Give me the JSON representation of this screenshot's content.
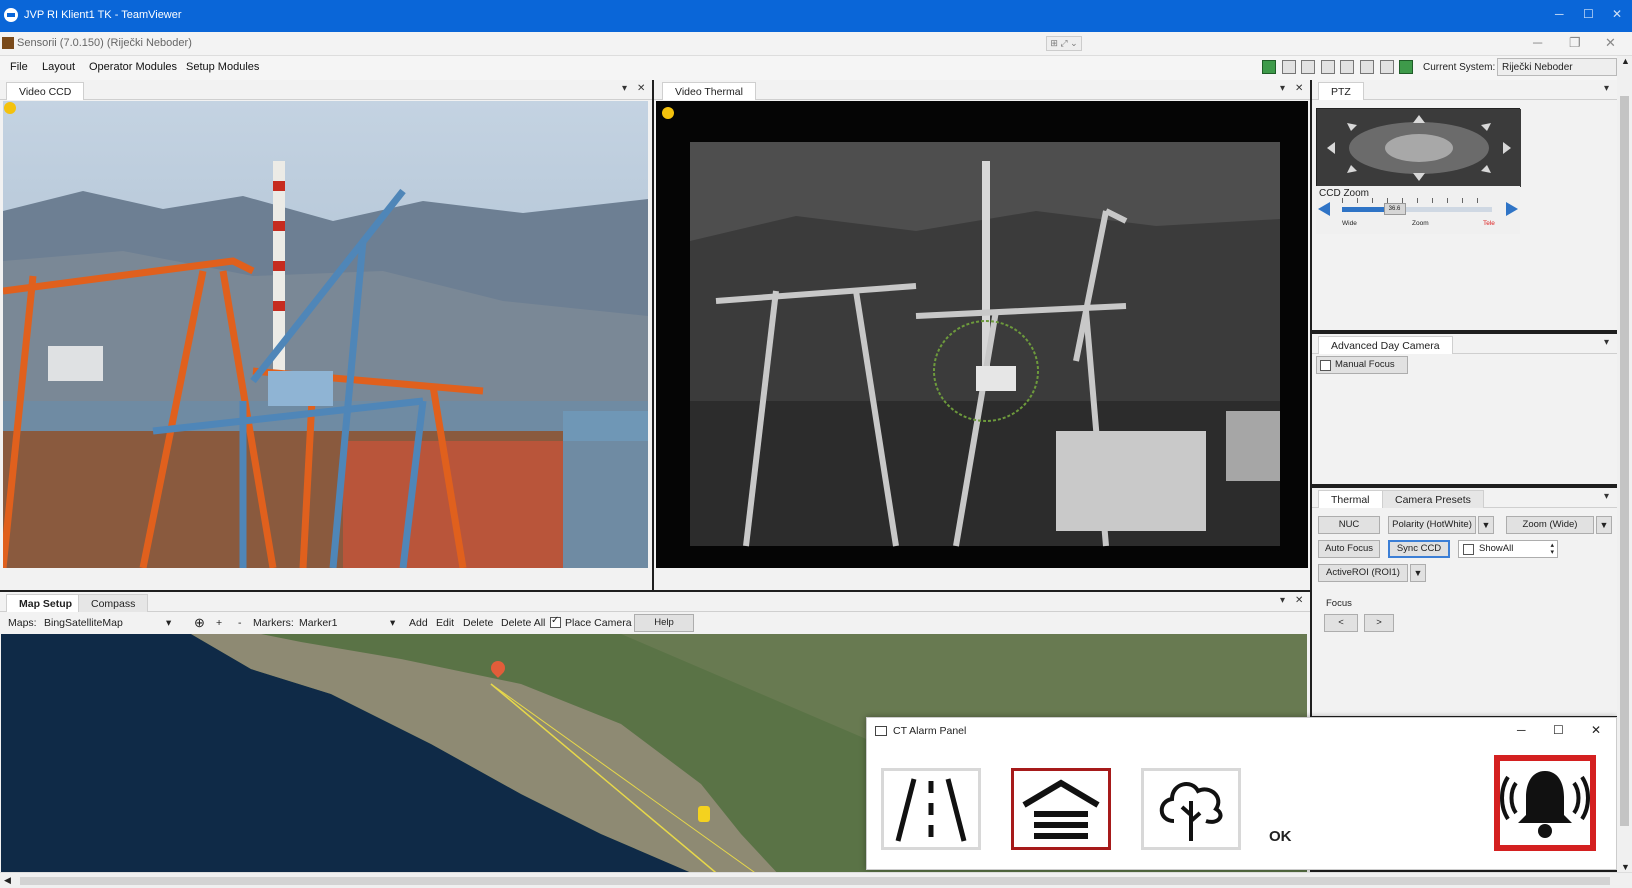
{
  "teamviewer": {
    "title": "JVP RI Klient1 TK - TeamViewer",
    "controls": [
      "─",
      "☐",
      "✕"
    ]
  },
  "app": {
    "title": "Sensorii (7.0.150) (Riječki Neboder)",
    "controls": [
      "─",
      "❐",
      "✕"
    ],
    "mini_controls": "⊞ ⤢ ⌄"
  },
  "menu": {
    "items": [
      "File",
      "Layout",
      "Operator Modules",
      "Setup Modules"
    ],
    "current_system_label": "Current System:",
    "current_system_value": "Riječki Neboder"
  },
  "video_ccd": {
    "tab": "Video CCD",
    "pin": "▾",
    "close": "✕"
  },
  "video_thermal": {
    "tab": "Video Thermal",
    "pin": "▾",
    "close": "✕"
  },
  "ptz": {
    "tab": "PTZ",
    "pin": "▾",
    "ccd_zoom_label": "CCD Zoom",
    "zoom_value": "36.6",
    "wide_label": "Wide",
    "zoom_label": "Zoom",
    "tele_label": "Tele",
    "zoom_level": 0.35
  },
  "advanced_day": {
    "tab": "Advanced Day Camera",
    "pin": "▾",
    "manual_focus": "Manual Focus"
  },
  "thermal": {
    "tabs": [
      "Thermal",
      "Camera Presets"
    ],
    "pin": "▾",
    "nuc": "NUC",
    "polarity": "Polarity (HotWhite)",
    "zoom": "Zoom (Wide)",
    "auto_focus": "Auto Focus",
    "sync_ccd": "Sync CCD",
    "show_all": "ShowAll",
    "active_roi": "ActiveROI (ROI1)",
    "focus_label": "Focus",
    "focus_prev": "<",
    "focus_next": ">"
  },
  "map": {
    "tabs": [
      "Map Setup",
      "Compass"
    ],
    "pin": "▾",
    "close": "✕",
    "maps_label": "Maps:",
    "maps_value": "BingSatelliteMap",
    "plus": "+",
    "minus": "-",
    "markers_label": "Markers:",
    "markers_value": "Marker1",
    "add": "Add",
    "edit": "Edit",
    "delete": "Delete",
    "delete_all": "Delete All",
    "place_camera": "Place Camera",
    "help": "Help"
  },
  "alarm_panel": {
    "title": "CT Alarm Panel",
    "controls": [
      "─",
      "☐",
      "✕"
    ],
    "ok": "OK"
  },
  "colors": {
    "teamviewer_blue": "#0a66d8",
    "alarm_red": "#d42020",
    "tile_selected": "#a61a1a",
    "status_yellow": "#f4c20d"
  },
  "icons": {
    "ccd_status": "status-dot-yellow",
    "thermal_status": "status-dot-yellow",
    "map_pin": "map-pin-icon",
    "camera_marker": "camera-marker-icon"
  }
}
